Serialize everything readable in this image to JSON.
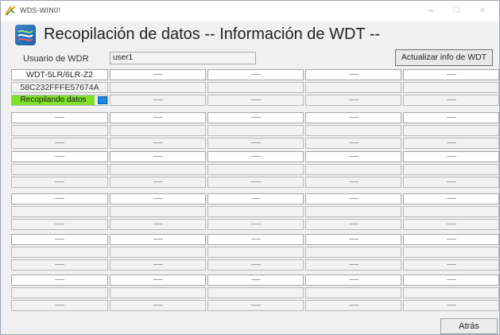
{
  "window": {
    "title": "WDS-WIN0!",
    "controls": {
      "minimize": "–",
      "maximize": "☐",
      "close": "✕"
    }
  },
  "header": {
    "title": "Recopilación de datos -- Información de WDT --"
  },
  "user": {
    "label": "Usuario de WDR",
    "value": "user1"
  },
  "buttons": {
    "refresh": "Actualizar info de WDT",
    "back": "Atrás"
  },
  "device": {
    "name": "WDT-5LR/6LR-Z2",
    "mac": "58C232FFFE57674A",
    "status": "Recopilando datos",
    "status_color": "#80e02c",
    "status_indicator_color": "#1e87e0"
  },
  "empty_cell": "----"
}
